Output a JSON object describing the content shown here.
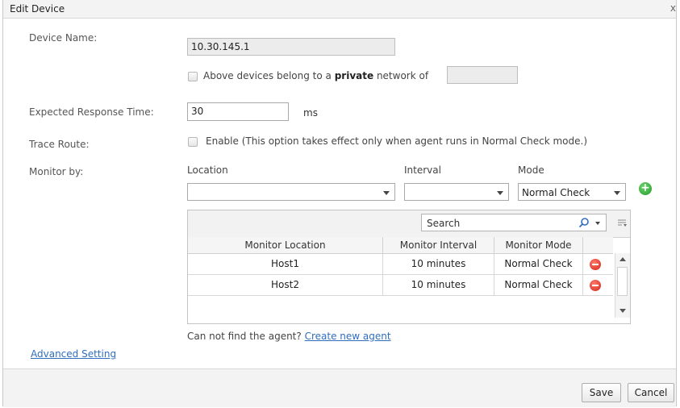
{
  "dialog": {
    "title": "Edit Device",
    "close_glyph": "x"
  },
  "form": {
    "device_name_label": "Device Name:",
    "device_name_value": "10.30.145.1",
    "private_network_text_pre": "Above devices belong to a ",
    "private_network_bold": "private",
    "private_network_text_post": " network of",
    "private_network_value": "",
    "private_network_checked": false,
    "expected_response_label": "Expected Response Time:",
    "expected_response_value": "30",
    "expected_response_unit": "ms",
    "trace_route_label": "Trace Route:",
    "trace_route_text": "Enable (This option takes effect only when agent runs in Normal Check mode.)",
    "trace_route_checked": false,
    "monitor_by_label": "Monitor by:"
  },
  "monitor": {
    "location_label": "Location",
    "interval_label": "Interval",
    "mode_label": "Mode",
    "location_value": "",
    "interval_value": "",
    "mode_value": "Normal Check",
    "add_icon": "add-icon"
  },
  "grid": {
    "search_placeholder": "Search",
    "columns": [
      "Monitor Location",
      "Monitor Interval",
      "Monitor Mode"
    ],
    "rows": [
      {
        "location": "Host1",
        "interval": "10 minutes",
        "mode": "Normal Check"
      },
      {
        "location": "Host2",
        "interval": "10 minutes",
        "mode": "Normal Check"
      }
    ]
  },
  "agent_hint": {
    "text": "Can not find the agent?",
    "link": "Create new agent"
  },
  "advanced_link": "Advanced Setting",
  "footer": {
    "save": "Save",
    "cancel": "Cancel"
  },
  "colors": {
    "link": "#2f6ebd",
    "add": "#1f9a2a",
    "remove": "#d2241b"
  }
}
